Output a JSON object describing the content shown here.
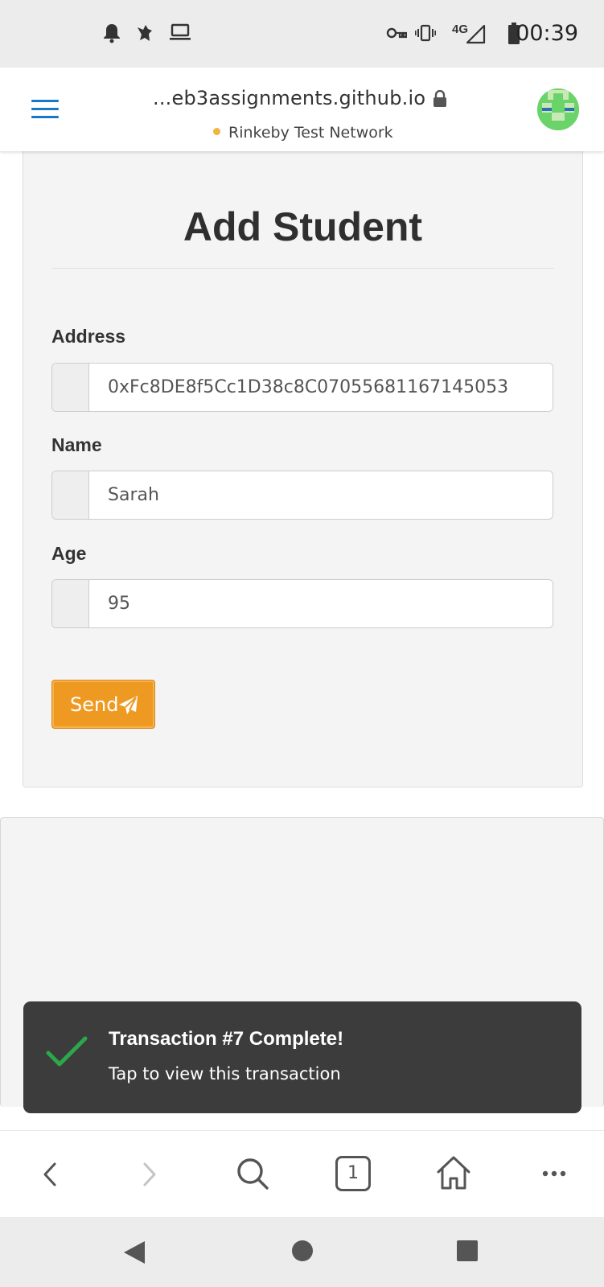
{
  "status_bar": {
    "time": "00:39",
    "network_type": "4G",
    "left_icons": [
      "bell-icon",
      "bird-icon",
      "laptop-icon"
    ],
    "right_icons": [
      "vpn-key-icon",
      "vibrate-icon",
      "signal-icon",
      "battery-icon"
    ]
  },
  "browser": {
    "url": "...eb3assignments.github.io",
    "network_name": "Rinkeby Test Network",
    "network_dot_color": "#f0b53e",
    "tab_count": "1"
  },
  "form": {
    "title": "Add Student",
    "fields": [
      {
        "label": "Address",
        "value": "0xFc8DE8f5Cc1D38c8C07055681167145053"
      },
      {
        "label": "Name",
        "value": "Sarah"
      },
      {
        "label": "Age",
        "value": "95"
      }
    ],
    "send_label": "Send",
    "send_color": "#ee9a22"
  },
  "toast": {
    "title": "Transaction #7 Complete!",
    "subtitle": "Tap to view this transaction",
    "check_color": "#2aa84a"
  },
  "colors": {
    "accent_blue": "#1778c8",
    "card_background": "#f4f4f4"
  }
}
